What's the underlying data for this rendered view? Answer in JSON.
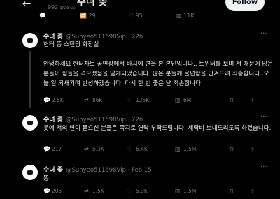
{
  "header": {
    "title": "수녀 좆",
    "post_count": "992 posts",
    "follow_label": "Follow",
    "top_actions": [
      {
        "icon": "reply-icon",
        "count": ""
      },
      {
        "icon": "retweet-icon",
        "count": "29"
      },
      {
        "icon": "like-icon",
        "count": "95"
      },
      {
        "icon": "views-icon",
        "count": "11K"
      }
    ]
  },
  "tweets": [
    {
      "name": "수녀 좆",
      "handle": "@Sunyeo511698Vip · 22h",
      "text": "헌터 똥 스탠딩 화장실\n\n안녕하세요 헌터차트 공연장에서 바지에 변을 본 본인입니다.. 트위터를 보며 저 때문에 많은 분들이 힘들을 겪으셨음을 알게되었습니다. 많은 분들께 불편함을 안겨드려 죄송합니다. 오늘 일 되새기며 반성하겠습니다. 다시 한 번 좋은 날 죄송합니다",
      "actions": {
        "reply": "2.5K",
        "retweet": "86K",
        "like": "125K",
        "views": "6M"
      }
    },
    {
      "name": "수녀 좆",
      "handle": "@Sunyeo511698Vip · 22h",
      "text": "옷에 저의 변이 묻으신 분들은 쪽지로 연락 부탁드립니다. 세탁비 보내드리도록 하겠습니다.",
      "actions": {
        "reply": "217",
        "retweet": "5.3K",
        "like": "6.4K",
        "views": "1.5M"
      }
    },
    {
      "name": "수녀 좆",
      "handle": "@Sunyeo511698Vip · Feb 15",
      "text": "똥",
      "actions": {
        "reply": "205",
        "retweet": "1.5K",
        "like": "5.3K",
        "views": "1.5M"
      }
    }
  ],
  "icons": {
    "back": "arrow-left-icon",
    "more": "more-icon",
    "reply": "reply-icon",
    "retweet": "retweet-icon",
    "like": "heart-icon",
    "views": "views-icon",
    "bookmark": "bookmark-icon",
    "share": "share-icon"
  }
}
